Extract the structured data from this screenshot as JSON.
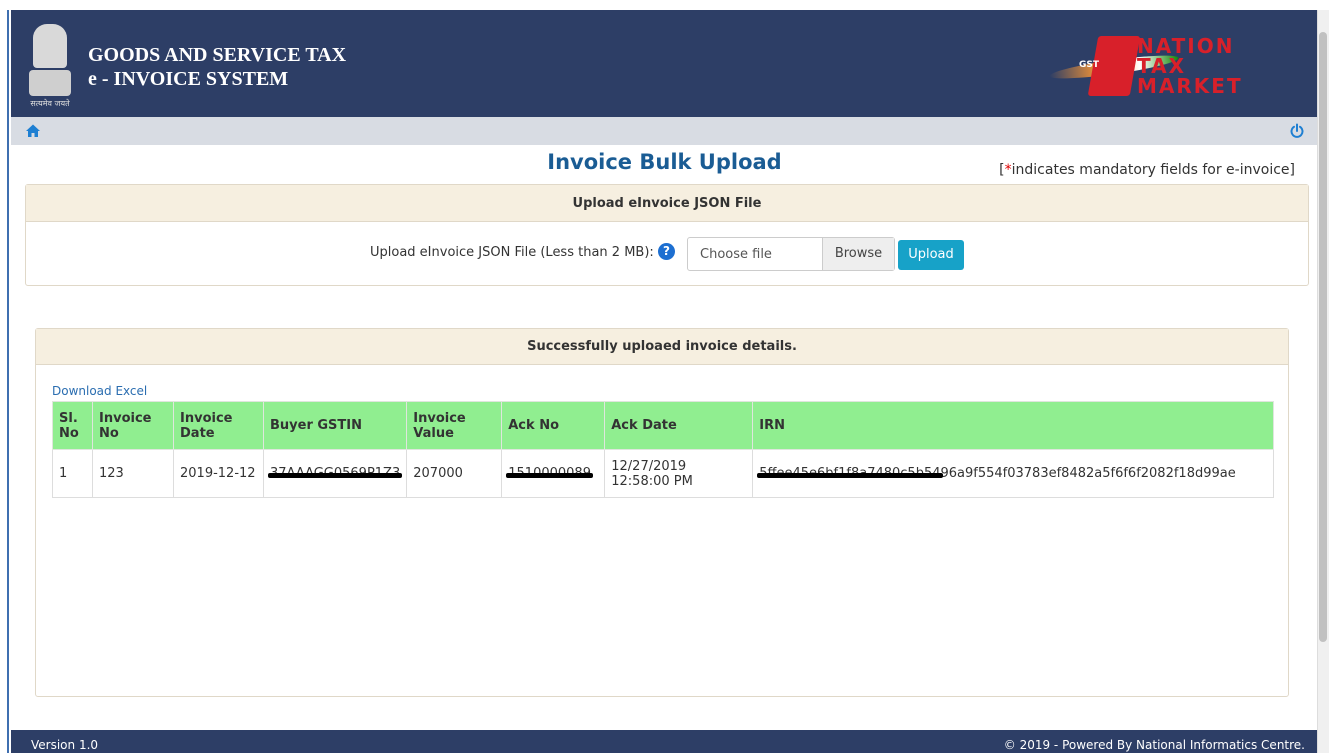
{
  "header": {
    "title_line1": "GOODS AND SERVICE TAX",
    "title_line2": "e - INVOICE SYSTEM",
    "emblem_motto": "सत्यमेव जयते",
    "logo": {
      "line1": "NATION",
      "line2": "TAX",
      "line3": "MARKET",
      "badge": "GST"
    }
  },
  "nav": {
    "home_icon": "home-icon",
    "power_icon": "power-icon"
  },
  "page": {
    "title": "Invoice Bulk Upload",
    "mandatory_prefix": "[",
    "mandatory_star": "*",
    "mandatory_text": "indicates mandatory fields for e-invoice]"
  },
  "upload_panel": {
    "heading": "Upload eInvoice JSON File",
    "label": "Upload eInvoice JSON File (Less than 2 MB):",
    "help": "?",
    "file_placeholder": "Choose file",
    "browse_label": "Browse",
    "upload_label": "Upload"
  },
  "results_panel": {
    "heading": "Successfully uploaed invoice details.",
    "download_link": "Download Excel",
    "columns": [
      [
        "Sl.",
        "No"
      ],
      [
        "Invoice",
        "No"
      ],
      [
        "Invoice",
        "Date"
      ],
      [
        "Buyer GSTIN",
        ""
      ],
      [
        "Invoice",
        "Value"
      ],
      [
        "Ack No",
        ""
      ],
      [
        "Ack Date",
        ""
      ],
      [
        "IRN",
        ""
      ]
    ],
    "rows": [
      {
        "sl_no": "1",
        "invoice_no": "123",
        "invoice_date": "2019-12-12",
        "buyer_gstin": "37AAAGG0569P1Z3",
        "invoice_value": "207000",
        "ack_no": "1510000089",
        "ack_date_1": "12/27/2019",
        "ack_date_2": "12:58:00 PM",
        "irn_redacted": "5ffee45e6bf1f8a7480c5b54",
        "irn_visible": "96a9f554f03783ef8482a5f6f6f2082f18d99ae"
      }
    ]
  },
  "footer": {
    "version": "Version 1.0",
    "copyright": "© 2019 - Powered By National Informatics Centre."
  },
  "colors": {
    "header_bg": "#2d3e66",
    "nav_bg": "#d8dce3",
    "title_blue": "#1a5c94",
    "table_header_green": "#90ee90",
    "upload_button": "#17a2c8",
    "panel_head_bg": "#f6efe0"
  }
}
